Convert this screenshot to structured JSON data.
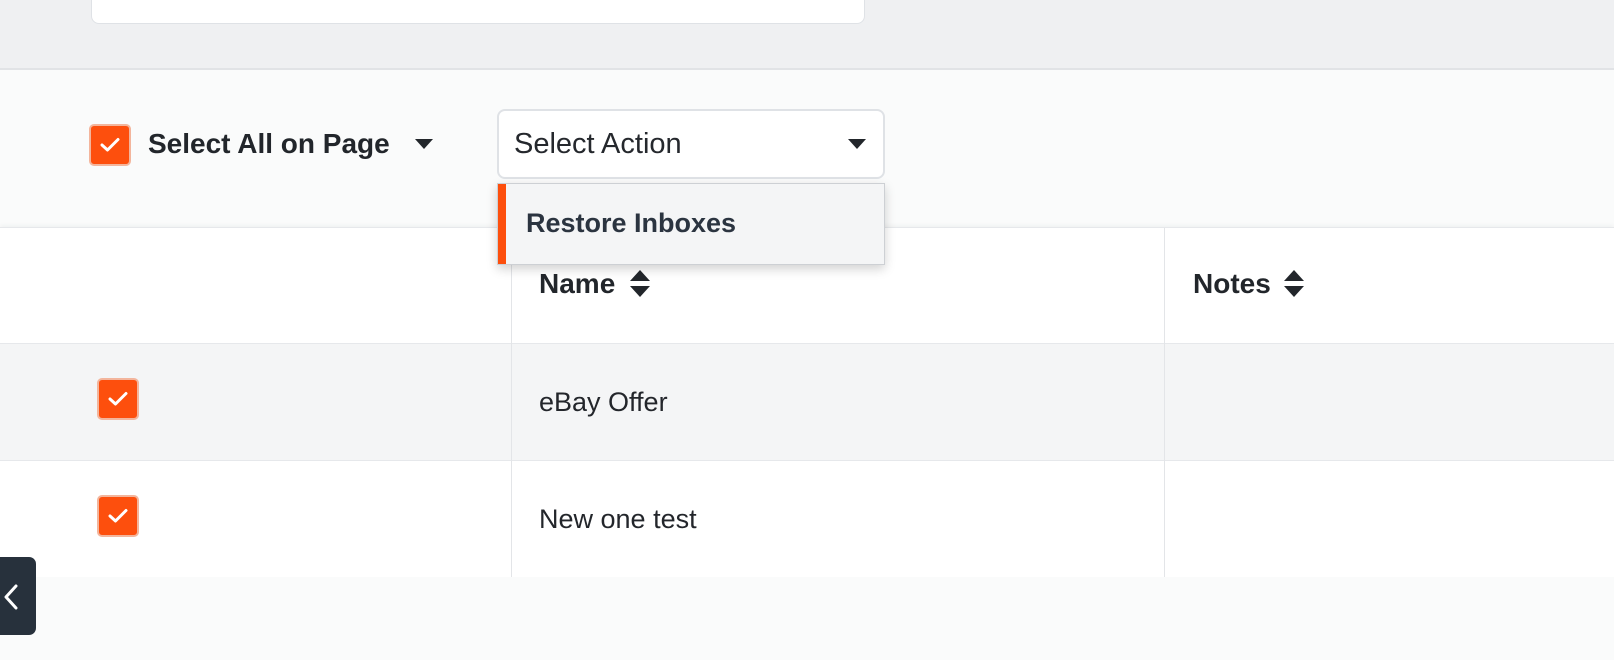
{
  "toolbar": {
    "select_all_label": "Select All on Page",
    "select_all_checked": true,
    "action_select": {
      "value": "Select Action",
      "options": [
        "Restore Inboxes"
      ]
    }
  },
  "table": {
    "columns": [
      {
        "label": ""
      },
      {
        "label": "Name"
      },
      {
        "label": "Notes"
      }
    ],
    "rows": [
      {
        "checked": true,
        "name": "eBay Offer",
        "notes": ""
      },
      {
        "checked": true,
        "name": "New one test",
        "notes": ""
      }
    ]
  },
  "icons": {
    "checkmark": "check-icon",
    "caret": "caret-down-icon",
    "sort": "sort-icon",
    "collapse": "chevron-left-icon"
  },
  "colors": {
    "accent": "#fd4f0d",
    "collapse_button": "#27313c",
    "top_band": "#eff0f2"
  }
}
